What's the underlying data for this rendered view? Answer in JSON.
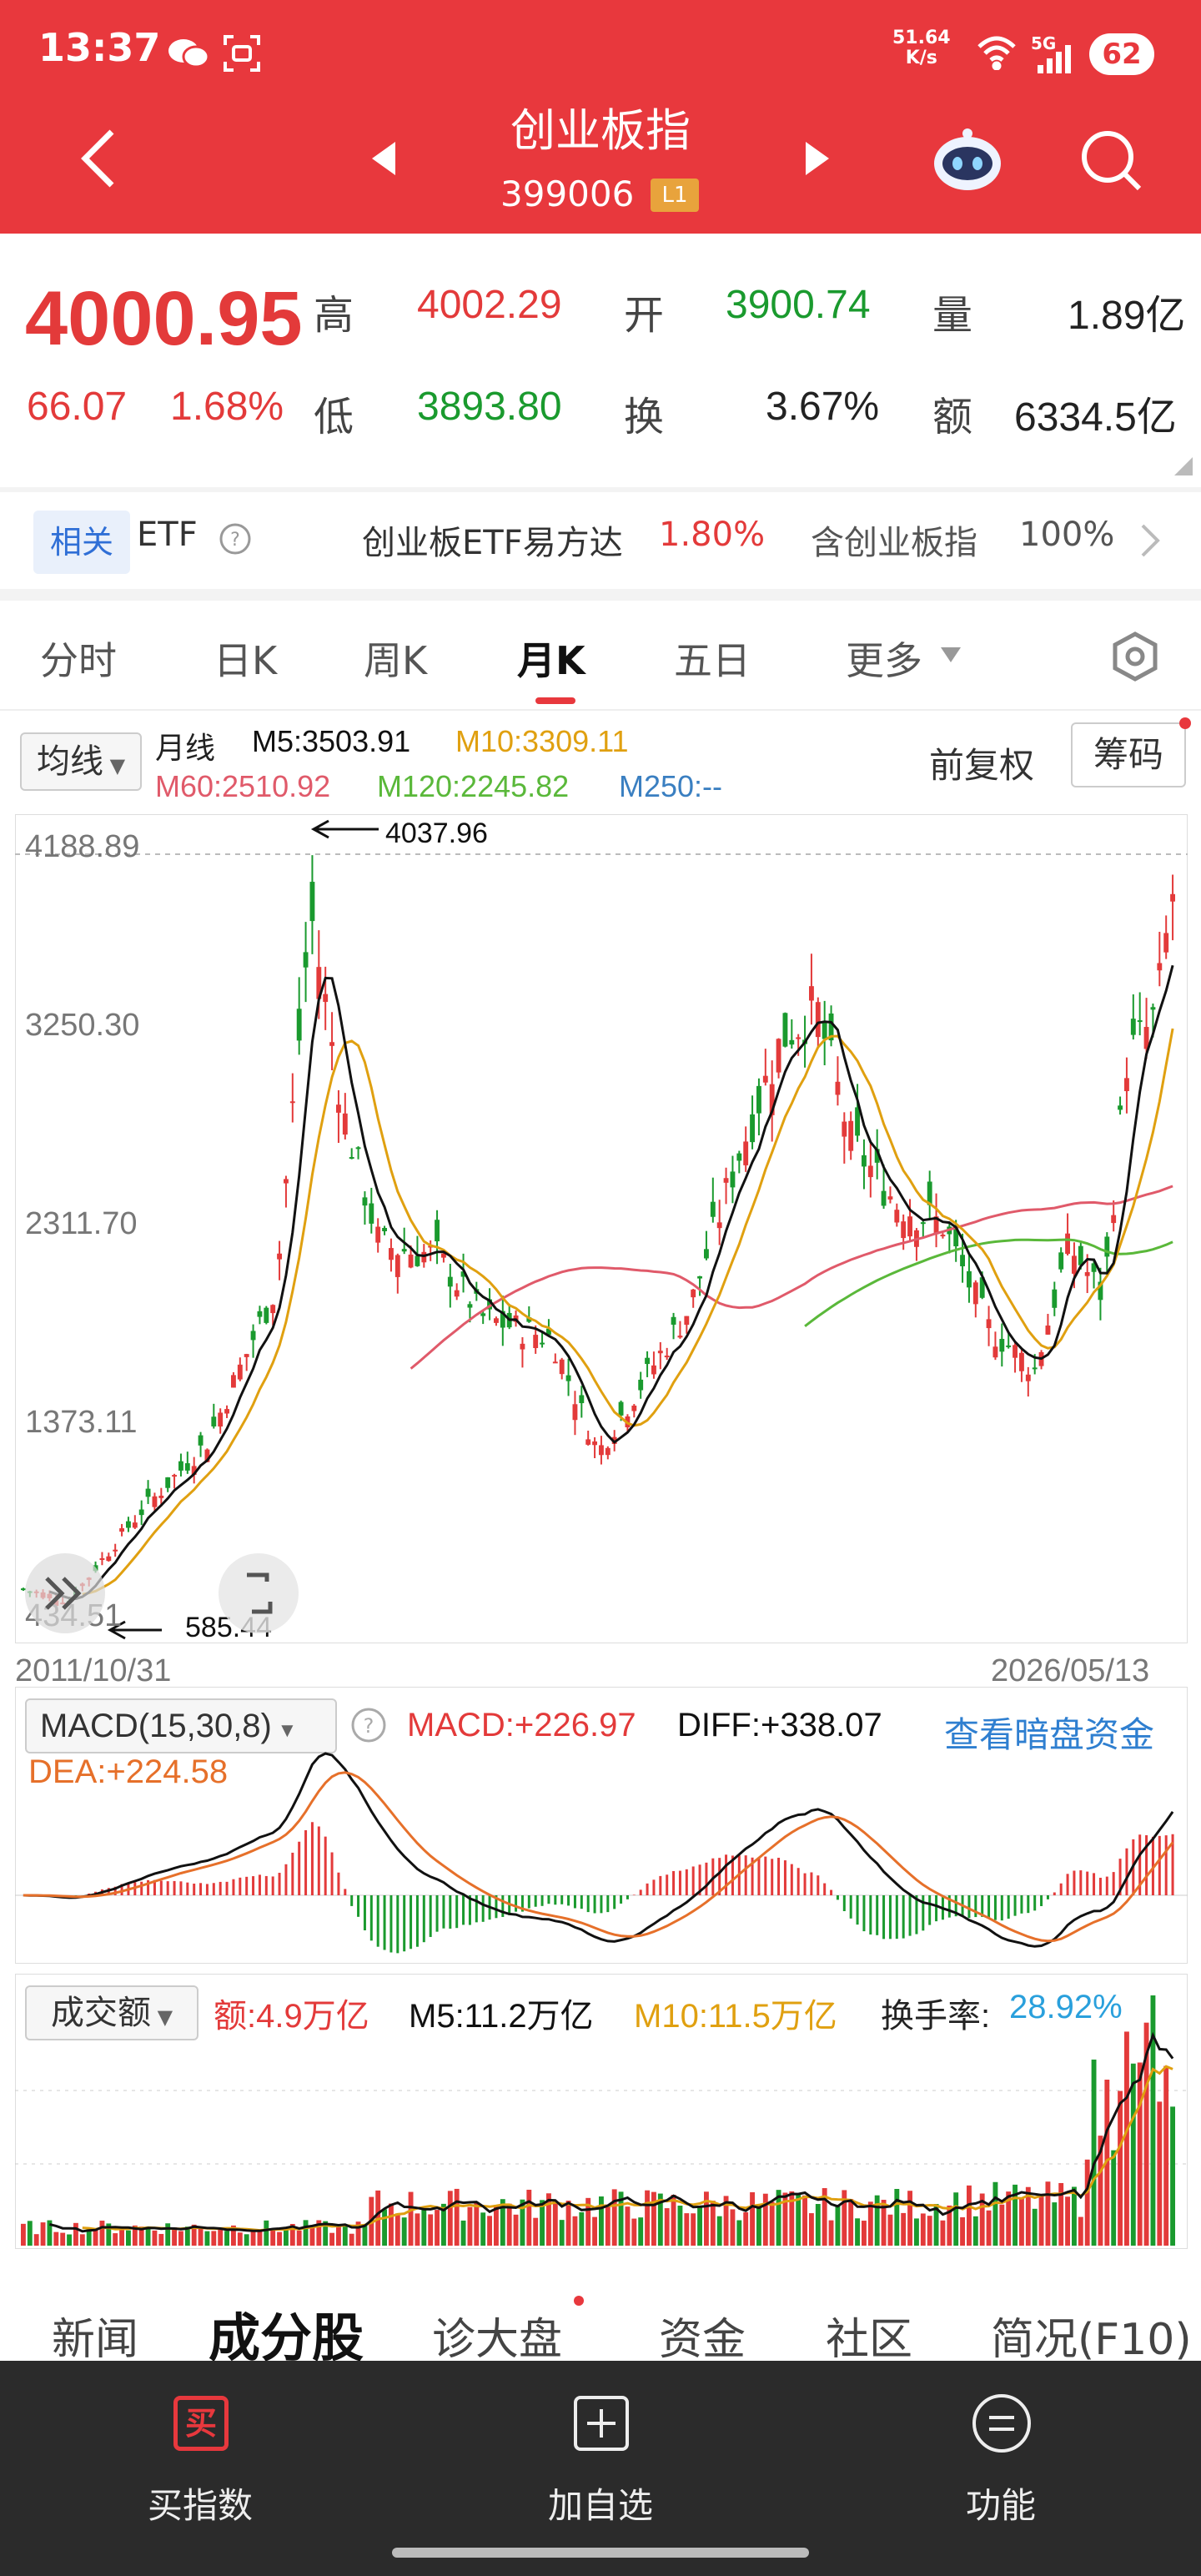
{
  "status": {
    "time": "13:37",
    "speed_value": "51.64",
    "speed_unit": "K/s",
    "network": "5G",
    "battery": "62"
  },
  "header": {
    "title": "创业板指",
    "code": "399006",
    "level": "L1"
  },
  "quote": {
    "price": "4000.95",
    "change": "66.07",
    "change_pct": "1.68%",
    "high_label": "高",
    "high": "4002.29",
    "open_label": "开",
    "open": "3900.74",
    "volume_label": "量",
    "volume": "1.89亿",
    "low_label": "低",
    "low": "3893.80",
    "turnover_label": "换",
    "turnover": "3.67%",
    "amount_label": "额",
    "amount": "6334.5亿"
  },
  "etf": {
    "tag": "相关",
    "label": "ETF",
    "name": "创业板ETF易方达",
    "pct": "1.80%",
    "contain": "含创业板指",
    "contain_pct": "100%"
  },
  "periods": [
    "分时",
    "日K",
    "周K",
    "月K",
    "五日",
    "更多"
  ],
  "active_period": "月K",
  "ma": {
    "selector": "均线",
    "type": "月线",
    "m5": "M5:3503.91",
    "m10": "M10:3309.11",
    "m60": "M60:2510.92",
    "m120": "M120:2245.82",
    "m250": "M250:--",
    "adjust": "前复权",
    "chips": "筹码"
  },
  "axis": {
    "y": [
      "4188.89",
      "3250.30",
      "2311.70",
      "1373.11",
      "434.51"
    ],
    "start_date": "2011/10/31",
    "end_date": "2026/05/13",
    "high_mark": "4037.96",
    "low_mark": "585.44"
  },
  "macd": {
    "selector": "MACD(15,30,8)",
    "macd": "MACD:+226.97",
    "diff": "DIFF:+338.07",
    "dea": "DEA:+224.58",
    "link": "查看暗盘资金"
  },
  "vol": {
    "selector": "成交额",
    "amount": "额:4.9万亿",
    "m5": "M5:11.2万亿",
    "m10": "M10:11.5万亿",
    "turnover_label": "换手率:",
    "turnover": "28.92%"
  },
  "bottom_tabs": [
    "新闻",
    "成分股",
    "诊大盘",
    "资金",
    "社区",
    "简况(F10)"
  ],
  "active_bottom_tab": "成分股",
  "actions": {
    "buy_icon": "买",
    "buy": "买指数",
    "add": "加自选",
    "func": "功能"
  },
  "colors": {
    "header": "#e8383d",
    "up": "#e33a3a",
    "down": "#1a9a2e",
    "m5": "#111111",
    "m10": "#e0a010",
    "m60": "#e05a6a",
    "m120": "#5ab83a"
  }
}
